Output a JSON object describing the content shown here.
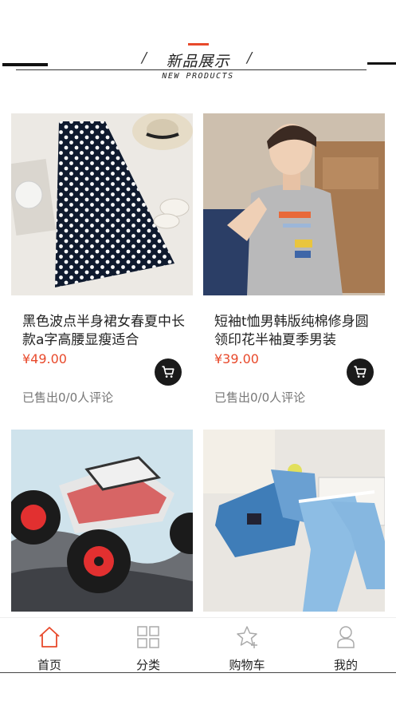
{
  "section": {
    "title": "新品展示",
    "subtitle": "NEW PRODUCTS"
  },
  "products": [
    {
      "title": "黑色波点半身裙女春夏中长款a字高腰显瘦适合",
      "price": "¥49.00",
      "sold": "已售出0/0人评论",
      "image": "polka-dot-skirt-photo"
    },
    {
      "title": "短袖t恤男韩版纯棉修身圆领印花半袖夏季男装",
      "price": "¥39.00",
      "sold": "已售出0/0人评论",
      "image": "man-gray-tshirt-photo"
    },
    {
      "title": "",
      "price": "",
      "sold": "",
      "image": "rc-crawler-truck-photo"
    },
    {
      "title": "",
      "price": "",
      "sold": "",
      "image": "kids-denim-pants-photo"
    }
  ],
  "tabs": [
    {
      "label": "首页",
      "icon": "home-icon",
      "active": true
    },
    {
      "label": "分类",
      "icon": "grid-icon",
      "active": false
    },
    {
      "label": "购物车",
      "icon": "star-add-icon",
      "active": false
    },
    {
      "label": "我的",
      "icon": "user-icon",
      "active": false
    }
  ],
  "colors": {
    "accent": "#e8492b",
    "price": "#e8492b",
    "text": "#222222",
    "muted": "#777777"
  }
}
